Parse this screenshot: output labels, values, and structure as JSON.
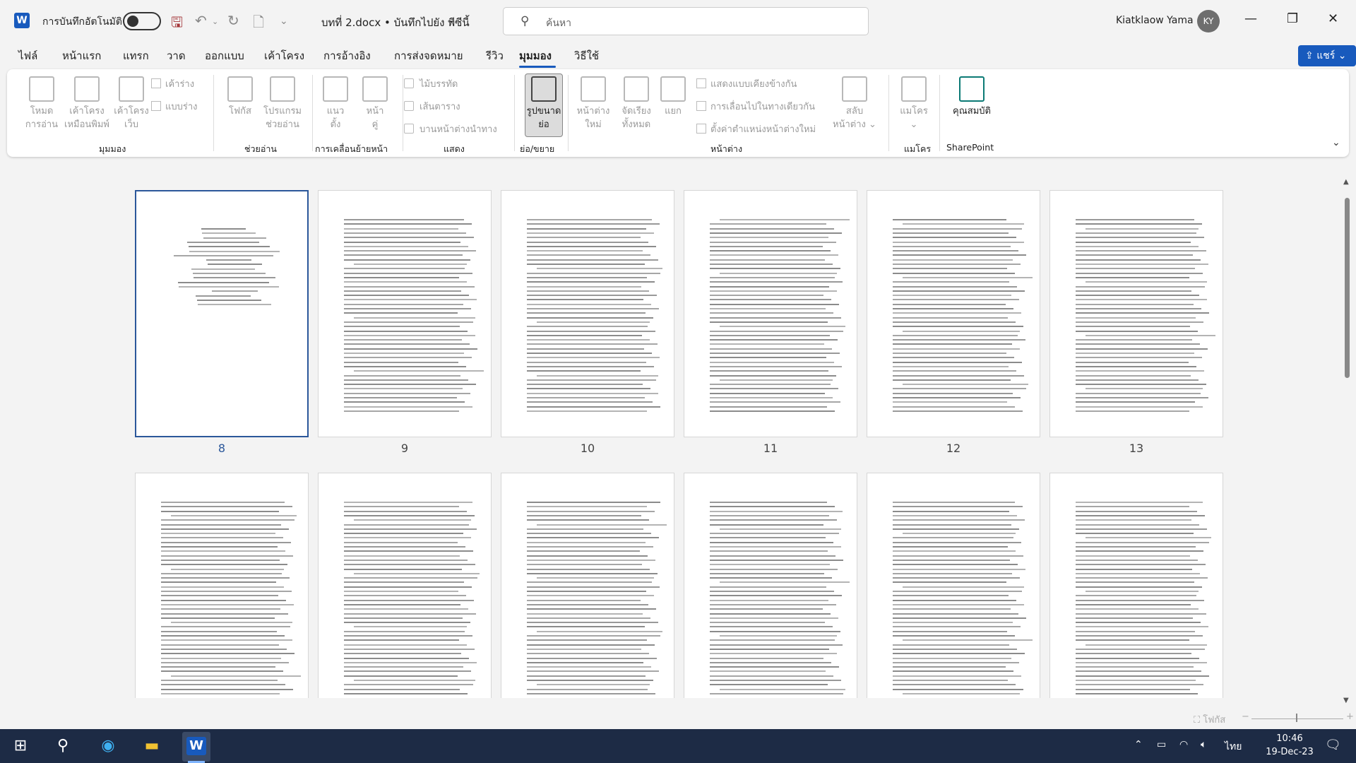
{
  "window": {
    "autosave_label": "การบันทึกอัตโนมัติ",
    "doc_title": "บทที่ 2.docx • บันทึกไปยัง พีซีนี้",
    "search_placeholder": "ค้นหา",
    "user_name": "Kiatklaow Yama",
    "avatar_initials": "KY",
    "accent_color": "#185abd"
  },
  "tabs": [
    {
      "label": "ไฟล์"
    },
    {
      "label": "หน้าแรก"
    },
    {
      "label": "แทรก"
    },
    {
      "label": "วาด"
    },
    {
      "label": "ออกแบบ"
    },
    {
      "label": "เค้าโครง"
    },
    {
      "label": "การอ้างอิง"
    },
    {
      "label": "การส่งจดหมาย"
    },
    {
      "label": "รีวิว"
    },
    {
      "label": "มุมมอง",
      "active": true
    },
    {
      "label": "วิธีใช้"
    }
  ],
  "share_label": "แชร์",
  "ribbon": {
    "views": {
      "read_mode": [
        "โหมด",
        "การอ่าน"
      ],
      "print_layout": [
        "เค้าโครง",
        "เหมือนพิมพ์"
      ],
      "web_layout": [
        "เค้าโครง",
        "เว็บ"
      ],
      "outline": "เค้าร่าง",
      "draft": "แบบร่าง",
      "group": "มุมมอง"
    },
    "immersive": {
      "focus": "โฟกัส",
      "immersive_reader": [
        "โปรแกรม",
        "ช่วยอ่าน"
      ],
      "group": "ช่วยอ่าน"
    },
    "page_movement": {
      "vertical": [
        "แนว",
        "ตั้ง"
      ],
      "side_to_side": [
        "หน้า",
        "คู่"
      ],
      "group": "การเคลื่อนย้ายหน้า"
    },
    "show": {
      "ruler": "ไม้บรรทัด",
      "gridlines": "เส้นตาราง",
      "nav_pane": "บานหน้าต่างนำทาง",
      "group": "แสดง"
    },
    "zoom": {
      "zoom_btn": [
        "รูปขนาด",
        "ย่อ"
      ],
      "group": "ย่อ/ขยาย"
    },
    "window": {
      "new_window": [
        "หน้าต่าง",
        "ใหม่"
      ],
      "arrange_all": [
        "จัดเรียง",
        "ทั้งหมด"
      ],
      "split": "แยก",
      "side_by_side": "แสดงแบบเคียงข้างกัน",
      "sync_scroll": "การเลื่อนไปในทางเดียวกัน",
      "reset_pos": "ตั้งค่าตำแหน่งหน้าต่างใหม่",
      "switch": [
        "สลับ",
        "หน้าต่าง"
      ],
      "group": "หน้าต่าง"
    },
    "macros": {
      "macros_btn": "แมโคร",
      "group": "แมโคร"
    },
    "sharepoint": {
      "properties": "คุณสมบัติ",
      "group": "SharePoint"
    }
  },
  "pages": [
    {
      "number": "8",
      "active": true
    },
    {
      "number": "9"
    },
    {
      "number": "10"
    },
    {
      "number": "11"
    },
    {
      "number": "12"
    },
    {
      "number": "13"
    },
    {
      "number": ""
    },
    {
      "number": ""
    },
    {
      "number": ""
    },
    {
      "number": ""
    },
    {
      "number": ""
    },
    {
      "number": ""
    }
  ],
  "status": {
    "focus_label": "โฟกัส"
  },
  "taskbar": {
    "language": "ไทย",
    "time": "10:46",
    "date": "19-Dec-23"
  }
}
